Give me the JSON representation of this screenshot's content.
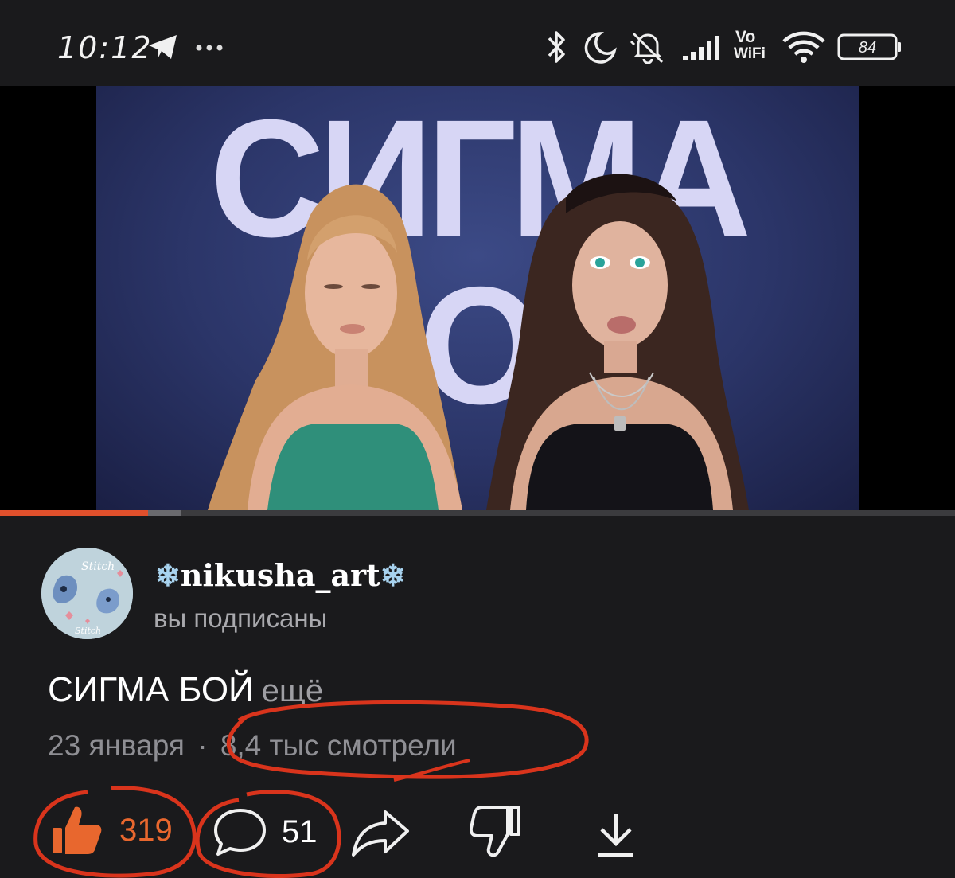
{
  "status_bar": {
    "time": "10:12",
    "battery_level": "84",
    "icons": [
      "telegram-icon",
      "more-dots-icon",
      "bluetooth-icon",
      "moon-icon",
      "bell-muted-icon",
      "signal-icon",
      "vowifi-icon",
      "wifi-icon",
      "battery-icon"
    ],
    "vowifi_label_top": "Vo",
    "vowifi_label_bottom": "WiFi"
  },
  "video": {
    "overlay_text": "СИГМА БОЙ",
    "progress": 0.155,
    "buffered": 0.19
  },
  "channel": {
    "name": "nikusha_art",
    "decoration": "❄",
    "subscription_status": "вы подписаны",
    "avatar_text": "Stitch"
  },
  "video_info": {
    "title": "СИГМА БОЙ",
    "more_label": "ещё",
    "date": "23 января",
    "separator": "·",
    "views": "8,4 тыс смотрели"
  },
  "actions": {
    "likes": "319",
    "comments": "51",
    "like_state": "liked"
  },
  "colors": {
    "accent": "#e8672e",
    "annotation": "#d9341c",
    "background": "#1a1a1c",
    "muted_text": "#8f8f94"
  }
}
